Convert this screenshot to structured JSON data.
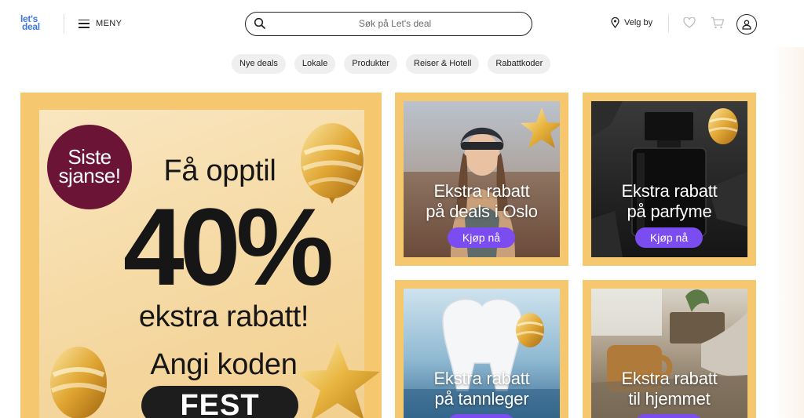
{
  "brand": {
    "logo_line1": "let's",
    "logo_line2": "deal",
    "accent": "#3f77e0"
  },
  "header": {
    "menu_label": "MENY",
    "search_placeholder": "Søk på Let's deal",
    "city_label": "Velg by"
  },
  "categories": [
    "Nye deals",
    "Lokale",
    "Produkter",
    "Reiser & Hotell",
    "Rabattkoder"
  ],
  "hero": {
    "badge_line1": "Siste",
    "badge_line2": "sjanse!",
    "line1": "Få opptil",
    "percent": "40%",
    "line2": "ekstra rabatt!",
    "line3": "Angi koden",
    "code": "FEST"
  },
  "cards": [
    {
      "line1": "Ekstra rabatt",
      "line2": "på deals i Oslo",
      "button": "Kjøp nå"
    },
    {
      "line1": "Ekstra rabatt",
      "line2": "på parfyme",
      "button": "Kjøp nå"
    },
    {
      "line1": "Ekstra rabatt",
      "line2": "på tannleger",
      "button": ""
    },
    {
      "line1": "Ekstra rabatt",
      "line2": "til hjemmet",
      "button": ""
    }
  ],
  "colors": {
    "frame_gold": "#f5c76f",
    "badge_burgundy": "#6b1436",
    "button_purple": "#7b4cf0"
  }
}
